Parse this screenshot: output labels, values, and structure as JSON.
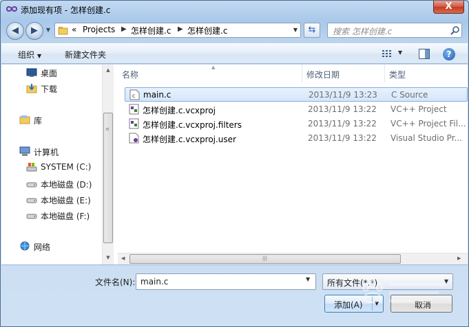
{
  "window": {
    "title": "添加现有项 - 怎样创建.c",
    "close_glyph": "X"
  },
  "address": {
    "overflow": "«",
    "crumbs": [
      "Projects",
      "怎样创建.c",
      "怎样创建.c"
    ],
    "separator": "▶"
  },
  "search": {
    "placeholder": "搜索 怎样创建.c"
  },
  "toolbar": {
    "organize_label": "组织",
    "new_folder_label": "新建文件夹"
  },
  "nav": {
    "items": [
      {
        "label": "桌面",
        "icon": "desktop-icon"
      },
      {
        "label": "下载",
        "icon": "downloads-icon"
      },
      {
        "label": "库",
        "icon": "library-icon"
      },
      {
        "label": "计算机",
        "icon": "computer-icon"
      },
      {
        "label": "SYSTEM (C:)",
        "icon": "system-drive-icon"
      },
      {
        "label": "本地磁盘 (D:)",
        "icon": "drive-icon"
      },
      {
        "label": "本地磁盘 (E:)",
        "icon": "drive-icon"
      },
      {
        "label": "本地磁盘 (F:)",
        "icon": "drive-icon"
      },
      {
        "label": "网络",
        "icon": "network-icon"
      }
    ]
  },
  "files": {
    "columns": [
      "名称",
      "修改日期",
      "类型"
    ],
    "rows": [
      {
        "name": "main.c",
        "date": "2013/11/9 13:23",
        "type": "C Source",
        "icon": "c-source-icon",
        "selected": true
      },
      {
        "name": "怎样创建.c.vcxproj",
        "date": "2013/11/9 13:22",
        "type": "VC++ Project",
        "icon": "vcxproj-icon",
        "selected": false
      },
      {
        "name": "怎样创建.c.vcxproj.filters",
        "date": "2013/11/9 13:22",
        "type": "VC++ Project Fil...",
        "icon": "filters-icon",
        "selected": false
      },
      {
        "name": "怎样创建.c.vcxproj.user",
        "date": "2013/11/9 13:22",
        "type": "Visual Studio Pr...",
        "icon": "vs-user-icon",
        "selected": false
      }
    ]
  },
  "bottom": {
    "filename_label": "文件名(N):",
    "filename_value": "main.c",
    "filter_value": "所有文件(*.*)",
    "add_label": "添加(A)",
    "cancel_label": "取消"
  },
  "colors": {
    "selection": "#d5e6fb",
    "accent": "#3c7fb1",
    "window": "#bcd5ef"
  }
}
